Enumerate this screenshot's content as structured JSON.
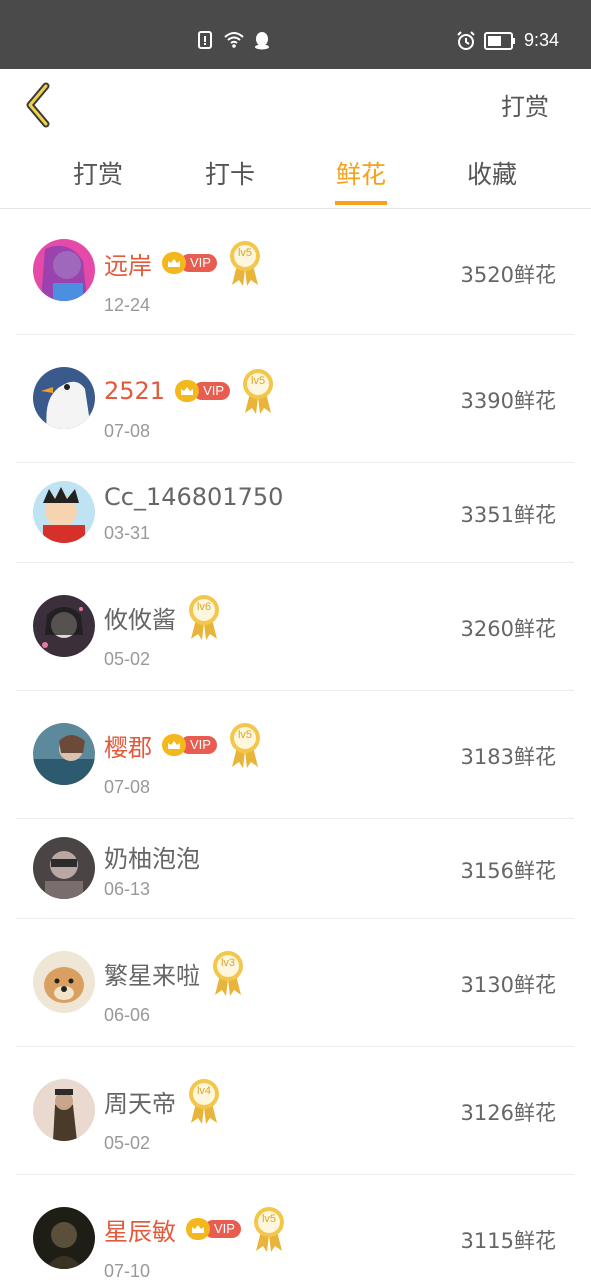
{
  "status_bar": {
    "time": "9:34",
    "icons": [
      "sim-alert-icon",
      "wifi-icon",
      "qq-penguin-icon",
      "alarm-icon",
      "battery-icon"
    ]
  },
  "header": {
    "back_icon": "chevron-left-icon",
    "action_label": "打赏"
  },
  "tabs": [
    {
      "label": "打赏",
      "active": false
    },
    {
      "label": "打卡",
      "active": false
    },
    {
      "label": "鲜花",
      "active": true
    },
    {
      "label": "收藏",
      "active": false
    }
  ],
  "colors": {
    "accent": "#f5a11a",
    "vip_name": "#e25a3c",
    "status_bar": "#4a4a4a"
  },
  "rows": [
    {
      "name": "远岸",
      "vip": true,
      "vip_label": "VIP",
      "level": "lv5",
      "date": "12-24",
      "amount": "3520鲜花"
    },
    {
      "name": "2521",
      "vip": true,
      "vip_label": "VIP",
      "level": "lv5",
      "date": "07-08",
      "amount": "3390鲜花"
    },
    {
      "name": "Cc_146801750",
      "vip": false,
      "level": "",
      "date": "03-31",
      "amount": "3351鲜花"
    },
    {
      "name": "攸攸酱",
      "vip": false,
      "level": "lv6",
      "date": "05-02",
      "amount": "3260鲜花"
    },
    {
      "name": "樱郡",
      "vip": true,
      "vip_label": "VIP",
      "level": "lv5",
      "date": "07-08",
      "amount": "3183鲜花"
    },
    {
      "name": "奶柚泡泡",
      "vip": false,
      "level": "",
      "date": "06-13",
      "amount": "3156鲜花"
    },
    {
      "name": "繁星来啦",
      "vip": false,
      "level": "lv3",
      "date": "06-06",
      "amount": "3130鲜花"
    },
    {
      "name": "周天帝",
      "vip": false,
      "level": "lv4",
      "date": "05-02",
      "amount": "3126鲜花"
    },
    {
      "name": "星辰敏",
      "vip": true,
      "vip_label": "VIP",
      "level": "lv5",
      "date": "07-10",
      "amount": "3115鲜花"
    }
  ]
}
